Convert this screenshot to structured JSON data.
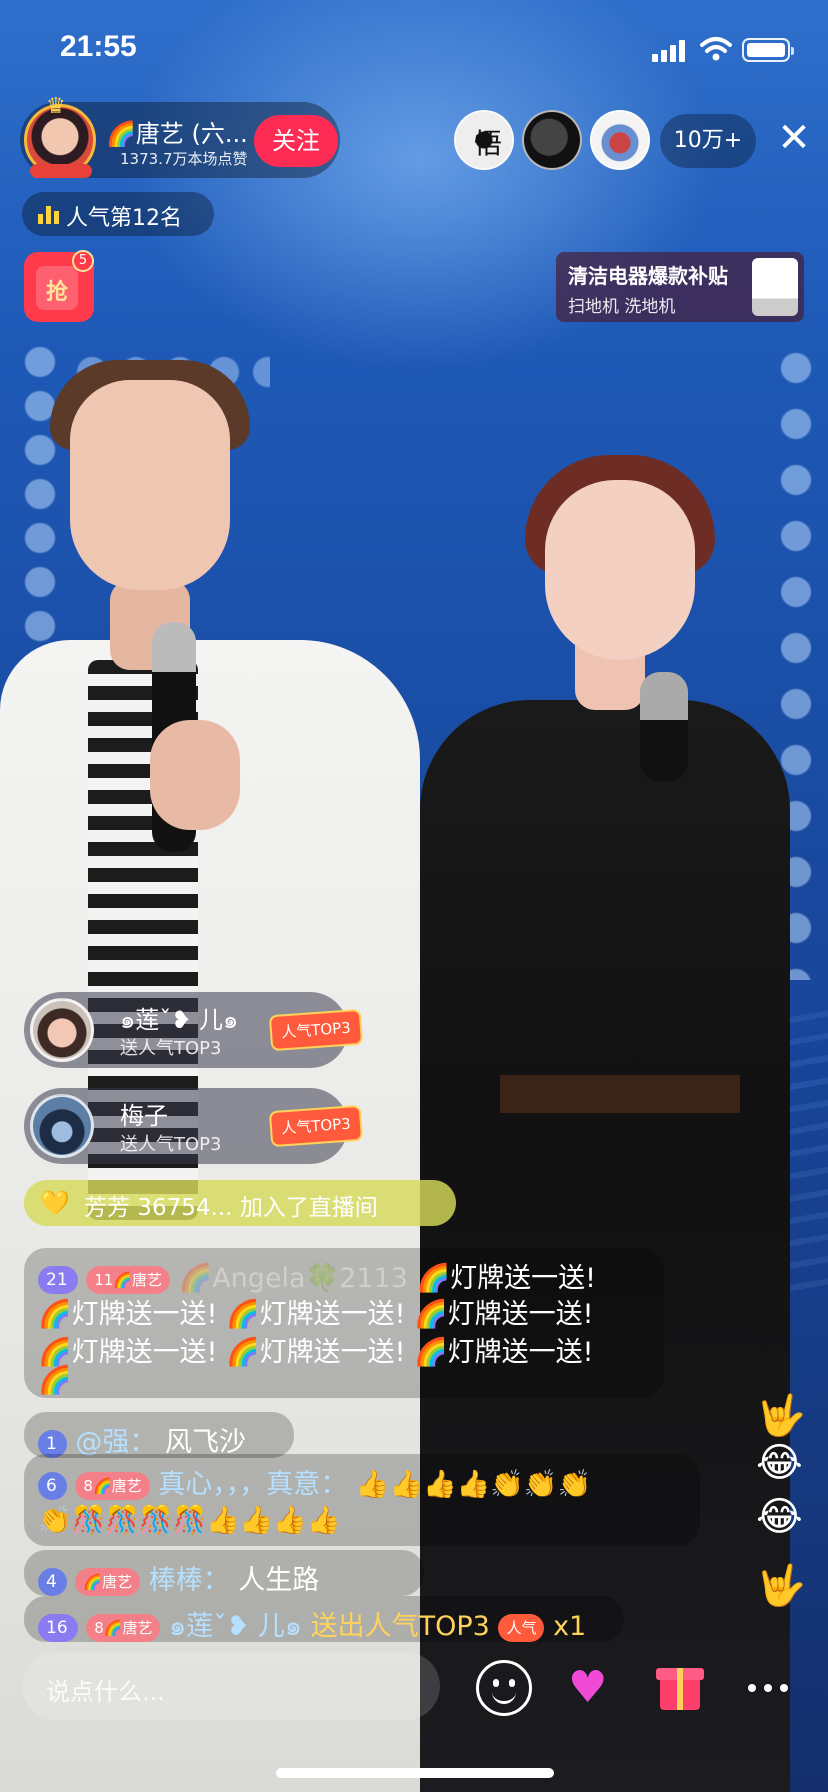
{
  "status_bar": {
    "time": "21:55"
  },
  "host": {
    "name": "🌈唐艺 (六...",
    "likes": "1373.7万本场点赞",
    "follow_label": "关注"
  },
  "viewers": {
    "count": "10万+",
    "viewer1_glyph": "悟"
  },
  "rank": {
    "text": "人气第12名"
  },
  "redpacket": {
    "char": "抢",
    "badge": "5"
  },
  "promo": {
    "title": "清洁电器爆款补贴",
    "subtitle": "扫地机 洗地机"
  },
  "gift_banners": [
    {
      "name": "๑莲ˇ❥ 儿๑",
      "subtitle": "送人气TOP3",
      "tag": "人气TOP3"
    },
    {
      "name": "梅子",
      "subtitle": "送人气TOP3",
      "tag": "人气TOP3"
    }
  ],
  "join_notice": {
    "icon": "💛",
    "text": "芳芳 36754... 加入了直播间"
  },
  "comments": [
    {
      "level": "21",
      "fan_badge": "11🌈唐艺",
      "user": "🌈Angela🍀2113",
      "lines": [
        "🌈灯牌送一送!",
        "🌈灯牌送一送!  🌈灯牌送一送!  🌈灯牌送一送!",
        "🌈灯牌送一送!  🌈灯牌送一送!  🌈灯牌送一送!",
        "🌈"
      ]
    },
    {
      "level": "1",
      "user": "@强：",
      "message": "风飞沙"
    },
    {
      "level": "6",
      "fan_badge": "8🌈唐艺",
      "user": "真心，，，真意：",
      "message": "👍👍👍👍👏👏👏",
      "message2": "👏🎊🎊🎊🎊👍👍👍👍"
    },
    {
      "level": "4",
      "fan_badge": "🌈唐艺",
      "user": "棒棒：",
      "message": "人生路"
    },
    {
      "level": "16",
      "fan_badge": "8🌈唐艺",
      "user": "๑莲ˇ❥ 儿๑",
      "message": "送出人气TOP3",
      "gift_tag": "人气",
      "count": "x1"
    }
  ],
  "floating_emojis": [
    "🤟",
    "😂",
    "😂",
    "🤟"
  ],
  "input": {
    "placeholder": "说点什么..."
  },
  "icons": {
    "signal": "signal-icon",
    "wifi": "wifi-icon",
    "battery": "battery-icon",
    "close": "close-icon",
    "smile": "emoji-icon",
    "heart": "heart-icon",
    "gift": "gift-icon",
    "more": "more-icon"
  },
  "colors": {
    "follow": "#fe2c55",
    "join": "#d6da5a",
    "rank_icon": "#ffd23f",
    "gift_tag": "#ff5a3c"
  }
}
